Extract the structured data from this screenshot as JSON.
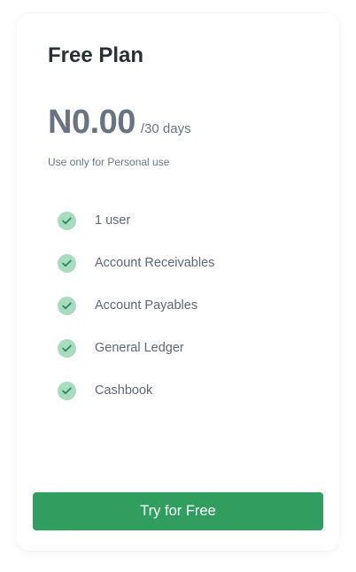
{
  "plan": {
    "title": "Free Plan",
    "price": "N0.00",
    "period": "/30 days",
    "note": "Use only for Personal use"
  },
  "features": [
    {
      "label": "1 user",
      "icon": "check-circle-icon"
    },
    {
      "label": "Account Receivables",
      "icon": "check-circle-icon"
    },
    {
      "label": "Account Payables",
      "icon": "check-circle-icon"
    },
    {
      "label": "General Ledger",
      "icon": "check-circle-icon"
    },
    {
      "label": "Cashbook",
      "icon": "check-circle-icon"
    }
  ],
  "cta": {
    "label": "Try for Free"
  },
  "colors": {
    "accent": "#2f9e5f",
    "check_bg": "#a8dcc0",
    "check_mark": "#2a8a55",
    "title": "#2b2f36",
    "muted_text": "#6b7280"
  }
}
